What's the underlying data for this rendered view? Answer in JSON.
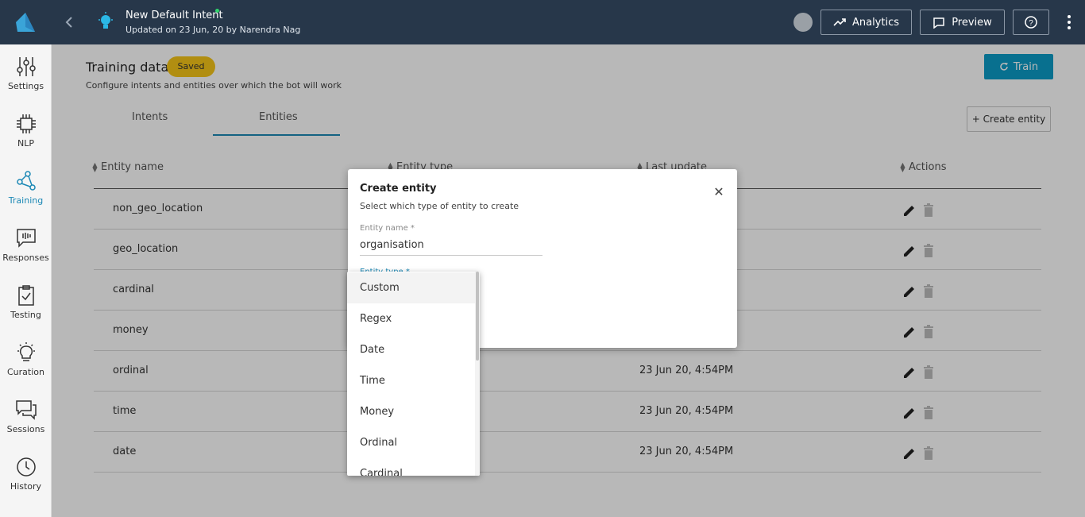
{
  "header": {
    "title": "New Default Intent",
    "subtitle": "Updated on 23 Jun, 20 by Narendra Nag",
    "analytics_label": "Analytics",
    "preview_label": "Preview"
  },
  "sidebar": {
    "items": [
      {
        "label": "Settings",
        "icon": "sliders-icon"
      },
      {
        "label": "NLP",
        "icon": "chip-icon"
      },
      {
        "label": "Training",
        "icon": "network-icon",
        "active": true
      },
      {
        "label": "Responses",
        "icon": "chat-wave-icon"
      },
      {
        "label": "Testing",
        "icon": "clipboard-check-icon"
      },
      {
        "label": "Curation",
        "icon": "lightbulb-icon"
      },
      {
        "label": "Sessions",
        "icon": "chat-bubbles-icon"
      },
      {
        "label": "History",
        "icon": "clock-icon"
      }
    ]
  },
  "main": {
    "title": "Training data",
    "badge": "Saved",
    "subtitle": "Configure intents and entities over which the bot will work",
    "train_label": "Train",
    "tabs": [
      "Intents",
      "Entities"
    ],
    "active_tab": "Entities",
    "create_entity_label": "+ Create entity"
  },
  "table": {
    "headers": [
      "Entity name",
      "Entity type",
      "Last update",
      "Actions"
    ],
    "rows": [
      {
        "name": "non_geo_location",
        "updated": ""
      },
      {
        "name": "geo_location",
        "updated": ""
      },
      {
        "name": "cardinal",
        "updated": ""
      },
      {
        "name": "money",
        "updated": ""
      },
      {
        "name": "ordinal",
        "updated": "23 Jun 20, 4:54PM"
      },
      {
        "name": "time",
        "updated": "23 Jun 20, 4:54PM"
      },
      {
        "name": "date",
        "updated": "23 Jun 20, 4:54PM"
      }
    ]
  },
  "modal": {
    "title": "Create entity",
    "subtitle": "Select which type of entity to create",
    "name_label": "Entity name *",
    "name_value": "organisation",
    "type_label": "Entity type *"
  },
  "dropdown": {
    "options": [
      "Custom",
      "Regex",
      "Date",
      "Time",
      "Money",
      "Ordinal",
      "Cardinal"
    ],
    "selected": "Custom"
  },
  "colors": {
    "topbar": "#27374a",
    "accent": "#1b88b5",
    "train_button": "#0c9cc7",
    "saved_badge": "#f5c518"
  }
}
